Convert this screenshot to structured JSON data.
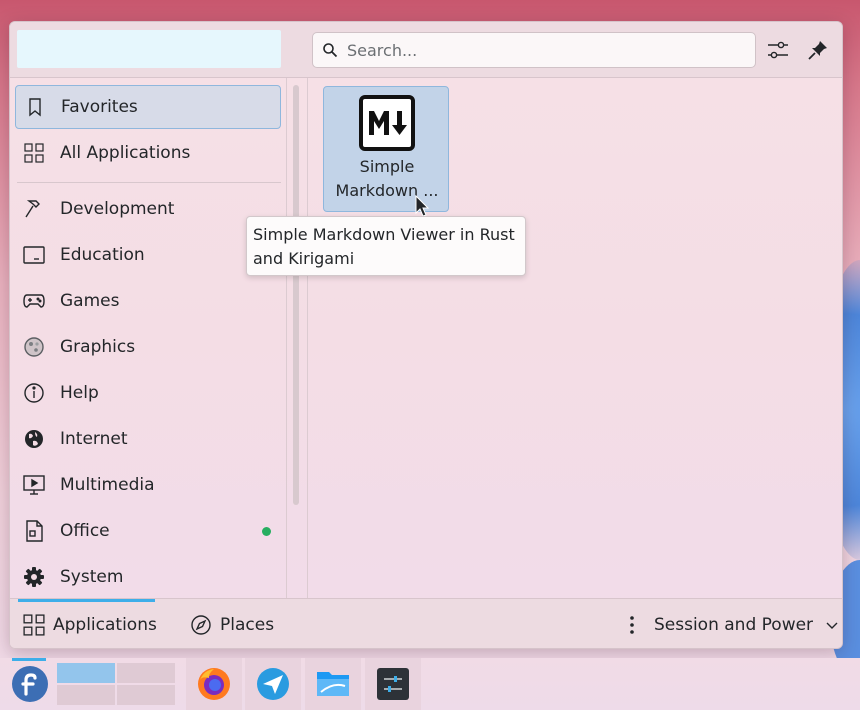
{
  "search": {
    "placeholder": "Search..."
  },
  "header": {
    "configure_icon": "sliders-icon",
    "pin_icon": "pin-icon"
  },
  "categories": [
    {
      "label": "Favorites",
      "icon": "bookmark-icon",
      "active": true
    },
    {
      "label": "All Applications",
      "icon": "grid-icon"
    },
    {
      "label": "Development",
      "icon": "hammer-icon"
    },
    {
      "label": "Education",
      "icon": "slate-icon"
    },
    {
      "label": "Games",
      "icon": "gamepad-icon"
    },
    {
      "label": "Graphics",
      "icon": "palette-icon"
    },
    {
      "label": "Help",
      "icon": "info-icon"
    },
    {
      "label": "Internet",
      "icon": "globe-icon"
    },
    {
      "label": "Multimedia",
      "icon": "monitor-play-icon"
    },
    {
      "label": "Office",
      "icon": "document-icon",
      "badge": true
    },
    {
      "label": "System",
      "icon": "gear-icon"
    }
  ],
  "app_tile": {
    "label_line1": "Simple",
    "label_line2": "Markdown ...",
    "icon": "markdown-icon"
  },
  "tooltip": {
    "line1": "Simple Markdown Viewer in Rust",
    "line2": "and Kirigami"
  },
  "footer": {
    "applications_label": "Applications",
    "places_label": "Places",
    "session_label": "Session and Power"
  },
  "colors": {
    "accent": "#3daee9",
    "badge": "#27ae60",
    "selection": "#c2d3e8"
  }
}
